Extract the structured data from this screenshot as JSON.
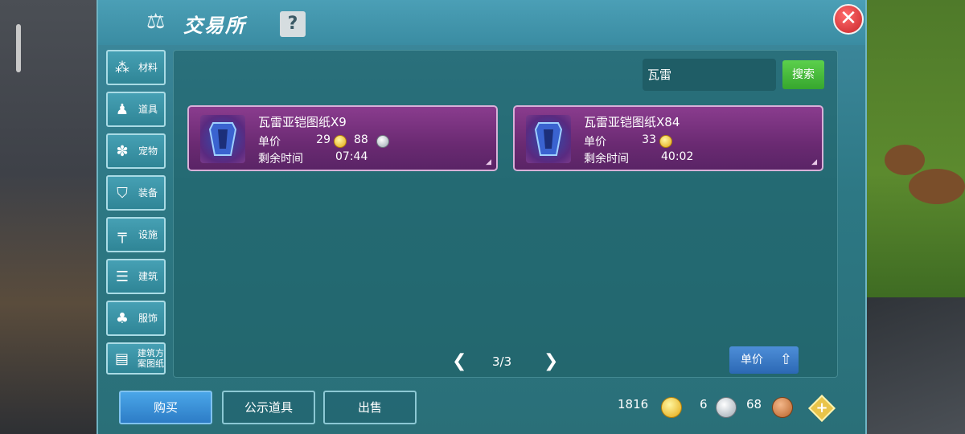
{
  "window": {
    "title": "交易所",
    "help_label": "?",
    "close_label": "✕"
  },
  "sidebar": {
    "items": [
      {
        "label": "材料",
        "icon": "materials-icon"
      },
      {
        "label": "道具",
        "icon": "props-icon"
      },
      {
        "label": "宠物",
        "icon": "paw-icon"
      },
      {
        "label": "装备",
        "icon": "equipment-icon"
      },
      {
        "label": "设施",
        "icon": "facility-icon"
      },
      {
        "label": "建筑",
        "icon": "building-icon"
      },
      {
        "label": "服饰",
        "icon": "clothing-icon"
      },
      {
        "label": "建筑方\n案图纸",
        "icon": "blueprint-icon"
      }
    ]
  },
  "search": {
    "value": "瓦雷",
    "button_label": "搜索"
  },
  "listings": [
    {
      "name": "瓦雷亚铠图纸X9",
      "price_label": "单价",
      "gold": "29",
      "silver": "88",
      "time_label": "剩余时间",
      "time_left": "07:44"
    },
    {
      "name": "瓦雷亚铠图纸X84",
      "price_label": "单价",
      "gold": "33",
      "time_label": "剩余时间",
      "time_left": "40:02"
    }
  ],
  "pagination": {
    "prev": "❮",
    "page": "3/3",
    "next": "❯"
  },
  "sort_button": {
    "label": "单价",
    "icon": "arrow-up-icon"
  },
  "tabs": [
    {
      "label": "购买",
      "active": true
    },
    {
      "label": "公示道具",
      "active": false
    },
    {
      "label": "出售",
      "active": false
    }
  ],
  "currency": {
    "gold": "1816",
    "silver": "6",
    "bronze": "68"
  },
  "colors": {
    "panel": "#2d7884",
    "card": "#7a3380",
    "accent_green": "#3fb034",
    "accent_blue": "#2d7cc6",
    "close_red": "#c8262b"
  }
}
